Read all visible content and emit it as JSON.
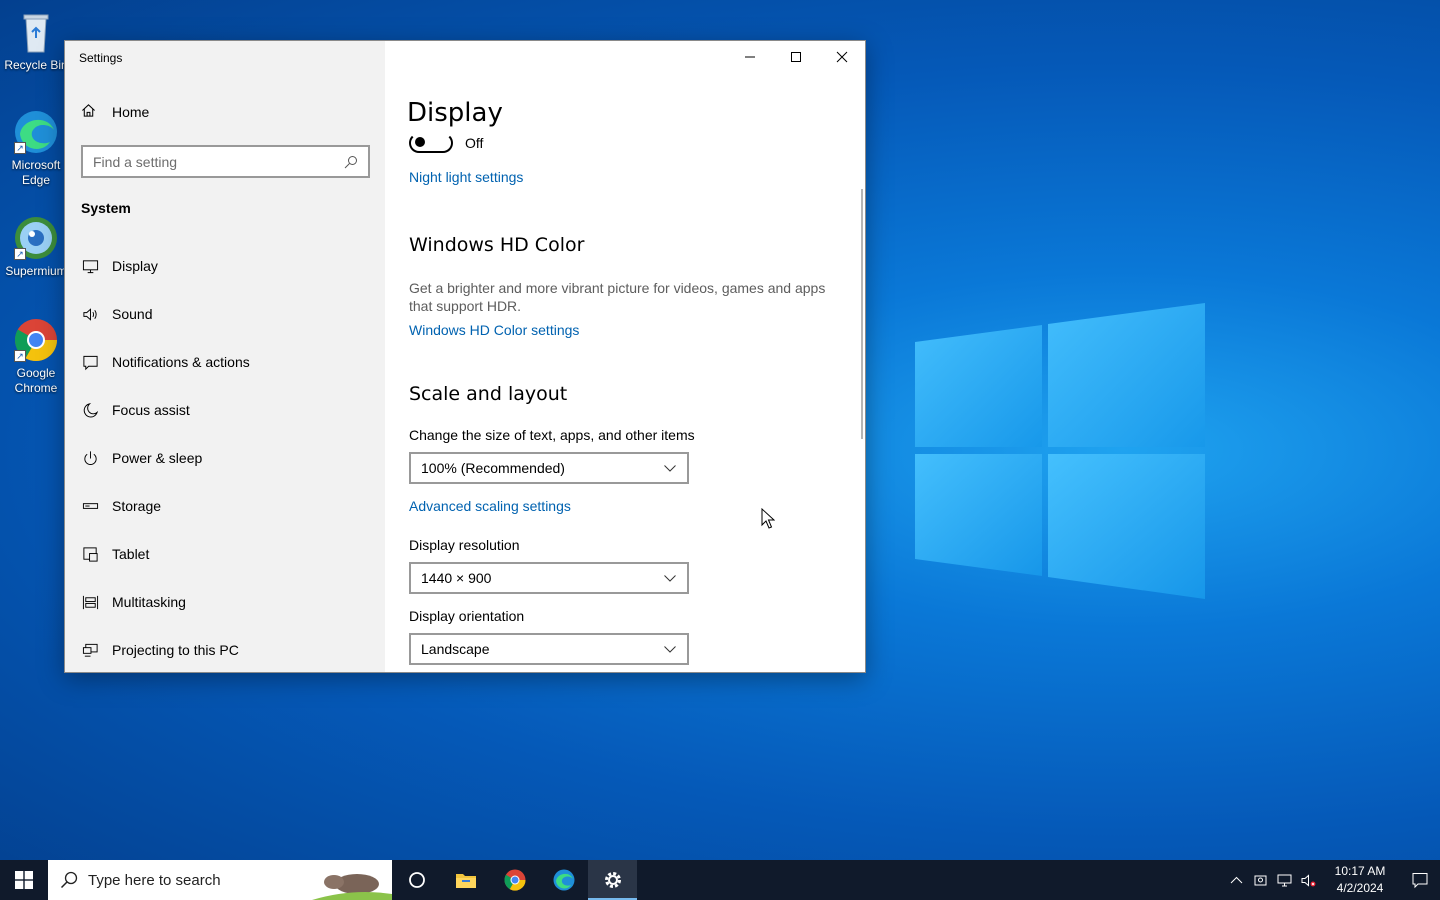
{
  "desktop": {
    "icons": [
      {
        "label": "Recycle Bin"
      },
      {
        "label": "Microsoft Edge"
      },
      {
        "label": "Supermium"
      },
      {
        "label": "Google Chrome"
      }
    ]
  },
  "window": {
    "title": "Settings",
    "controls": {
      "minimize": "minimize-icon",
      "maximize": "maximize-icon",
      "close": "close-icon"
    }
  },
  "sidebar": {
    "home_label": "Home",
    "search_placeholder": "Find a setting",
    "section_heading": "System",
    "items": [
      {
        "label": "Display",
        "icon": "monitor-icon"
      },
      {
        "label": "Sound",
        "icon": "speaker-icon"
      },
      {
        "label": "Notifications & actions",
        "icon": "notification-icon"
      },
      {
        "label": "Focus assist",
        "icon": "moon-icon"
      },
      {
        "label": "Power & sleep",
        "icon": "power-icon"
      },
      {
        "label": "Storage",
        "icon": "storage-icon"
      },
      {
        "label": "Tablet",
        "icon": "tablet-icon"
      },
      {
        "label": "Multitasking",
        "icon": "multitasking-icon"
      },
      {
        "label": "Projecting to this PC",
        "icon": "projecting-icon"
      }
    ],
    "active_item": "Display"
  },
  "content": {
    "page_title": "Display",
    "night_light_state": "Off",
    "night_light_link": "Night light settings",
    "hd_color": {
      "heading": "Windows HD Color",
      "description": "Get a brighter and more vibrant picture for videos, games and apps that support HDR.",
      "link": "Windows HD Color settings"
    },
    "scale_layout": {
      "heading": "Scale and layout",
      "scale_label": "Change the size of text, apps, and other items",
      "scale_value": "100% (Recommended)",
      "advanced_link": "Advanced scaling settings",
      "resolution_label": "Display resolution",
      "resolution_value": "1440 × 900",
      "orientation_label": "Display orientation",
      "orientation_value": "Landscape"
    }
  },
  "taskbar": {
    "search_placeholder": "Type here to search",
    "pinned": [
      "task-view-icon",
      "file-explorer-icon",
      "chrome-icon",
      "edge-icon",
      "settings-icon"
    ],
    "active": "settings-icon",
    "clock_time": "10:17 AM",
    "clock_date": "4/2/2024"
  },
  "colors": {
    "accent": "#0067c0",
    "link": "#0062b0",
    "taskbar": "#101a2b",
    "desktop": "#0a78d7"
  }
}
